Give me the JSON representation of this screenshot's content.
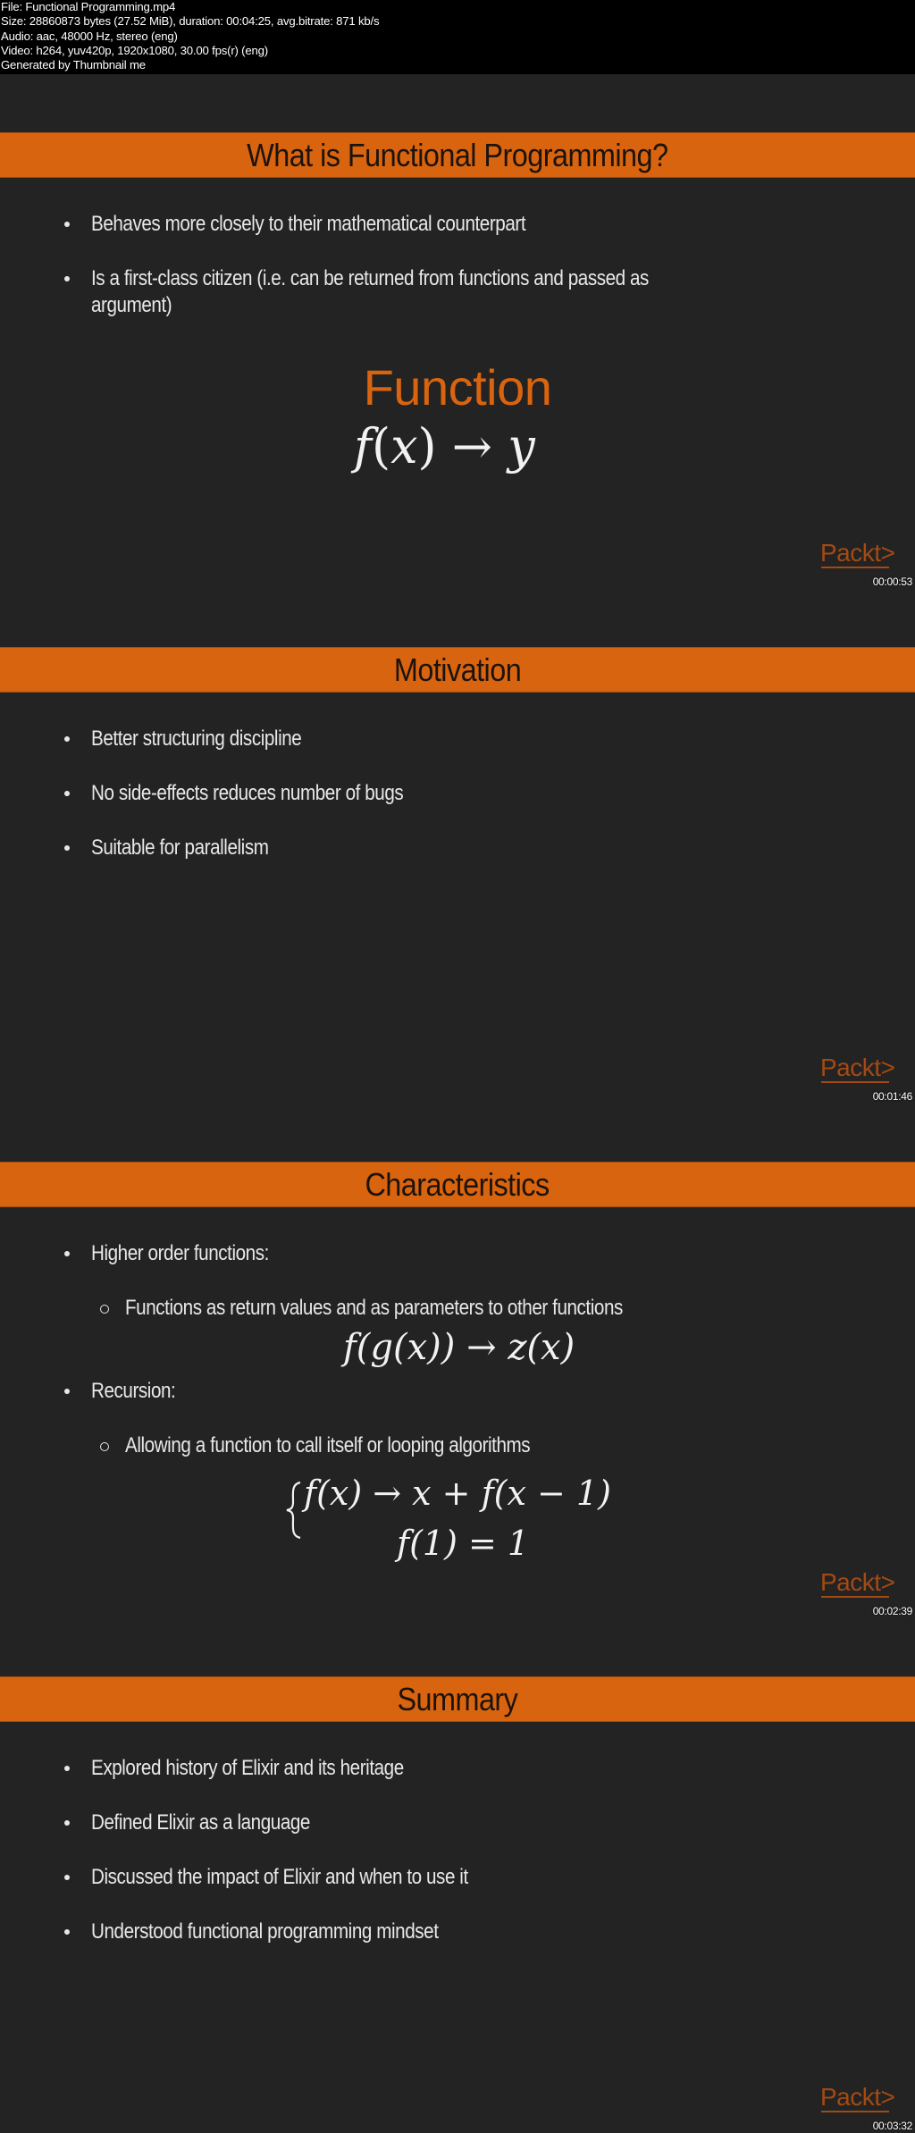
{
  "file_info": {
    "lines": [
      "File: Functional Programming.mp4",
      "Size: 28860873 bytes (27.52 MiB), duration: 00:04:25, avg.bitrate: 871 kb/s",
      "Audio: aac, 48000 Hz, stereo (eng)",
      "Video: h264, yuv420p, 1920x1080, 30.00 fps(r) (eng)",
      "Generated by Thumbnail me"
    ]
  },
  "theme": {
    "accent_color": "#d9640f",
    "slide_background": "#232323",
    "header_background": "#000000",
    "text_color": "#e8e8e8"
  },
  "frames": [
    {
      "title": "What is Functional Programming?",
      "bullets": [
        "Behaves more closely to their mathematical counterpart",
        "Is a first-class citizen (i.e. can be returned from functions and passed as",
        "argument)"
      ],
      "highlight_label": "Function",
      "formula": {
        "f": "f",
        "open": "(",
        "x": "x",
        "close": ")",
        "arrow": "→",
        "y": "y"
      },
      "logo": "Packt>",
      "timestamp": "00:00:53"
    },
    {
      "title": "Motivation",
      "bullets": [
        "Better structuring discipline",
        "No side-effects reduces number of bugs",
        "Suitable for parallelism"
      ],
      "logo": "Packt>",
      "timestamp": "00:01:46"
    },
    {
      "title": "Characteristics",
      "bullets": [
        "Higher order functions:",
        "Recursion:"
      ],
      "sub_bullets": [
        "Functions as return values and as parameters to other functions",
        "Allowing a function to call itself or looping algorithms"
      ],
      "formula_composition": "f(g(x)) → z(x)",
      "formula_recursion": {
        "line1": "f(x) → x + f(x − 1)",
        "line2": "f(1) = 1"
      },
      "logo": "Packt>",
      "timestamp": "00:02:39"
    },
    {
      "title": "Summary",
      "bullets": [
        "Explored history of Elixir and its heritage",
        "Defined Elixir as a language",
        "Discussed the impact of Elixir and when to use it",
        "Understood functional programming mindset"
      ],
      "logo": "Packt>",
      "timestamp": "00:03:32"
    }
  ]
}
